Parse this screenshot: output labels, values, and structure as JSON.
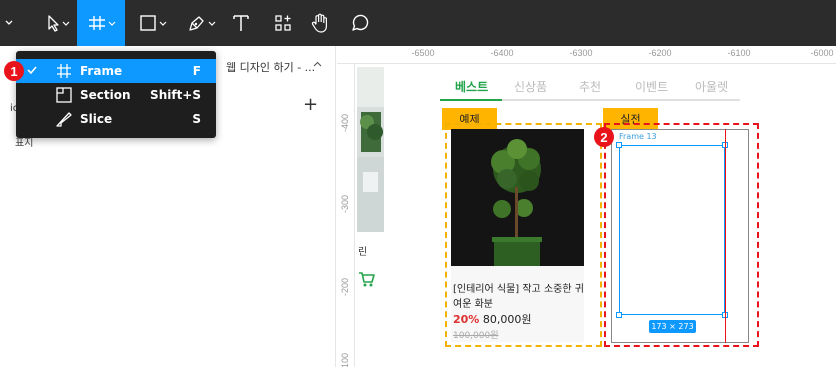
{
  "toolbar": {
    "tools": [
      {
        "name": "move-tool",
        "icon": "pointer-arrow-icon"
      },
      {
        "name": "frame-tool",
        "icon": "frame-hash-icon",
        "active": true
      },
      {
        "name": "shape-tool",
        "icon": "rectangle-icon"
      },
      {
        "name": "pen-tool",
        "icon": "pen-icon"
      },
      {
        "name": "text-tool",
        "icon": "text-t-icon"
      },
      {
        "name": "resources-tool",
        "icon": "components-icon"
      },
      {
        "name": "hand-tool",
        "icon": "hand-icon"
      },
      {
        "name": "comment-tool",
        "icon": "comment-bubble-icon"
      }
    ],
    "colors": {
      "bg": "#2c2c2c",
      "active": "#0d99ff"
    }
  },
  "menu": {
    "items": [
      {
        "label": "Frame",
        "shortcut": "F",
        "icon": "frame-hash-icon",
        "checked": true,
        "highlighted": true
      },
      {
        "label": "Section",
        "shortcut": "Shift+S",
        "icon": "section-icon",
        "checked": false,
        "highlighted": false
      },
      {
        "label": "Slice",
        "shortcut": "S",
        "icon": "slice-knife-icon",
        "checked": false,
        "highlighted": false
      }
    ]
  },
  "badges": {
    "one": "1",
    "two": "2"
  },
  "left_panel": {
    "page_title": "웹 디자인 하기 - ...",
    "fragment_top": "ic",
    "fragment_text": "표지"
  },
  "ruler": {
    "x_ticks": [
      "-6500",
      "-6400",
      "-6300",
      "-6200",
      "-6100",
      "-6000"
    ],
    "y_ticks": [
      "-400",
      "-300",
      "-200",
      "-100"
    ]
  },
  "canvas": {
    "strip_label": "린",
    "tabs": [
      "베스트",
      "신상품",
      "추천",
      "이벤트",
      "아울렛"
    ],
    "example": {
      "tag": "예제",
      "title": "[인테리어 식물]  작고 소중한 귀여운 화분",
      "discount": "20%",
      "price": "80,000원",
      "old_price": "100,000원"
    },
    "practice": {
      "tag": "실전",
      "frame_name": "Frame 13",
      "size": "173 × 273"
    }
  },
  "colors": {
    "accent_green": "#23a34a",
    "tag_yellow": "#ffb400",
    "danger_red": "#e8131b",
    "selection_blue": "#0d99ff"
  }
}
